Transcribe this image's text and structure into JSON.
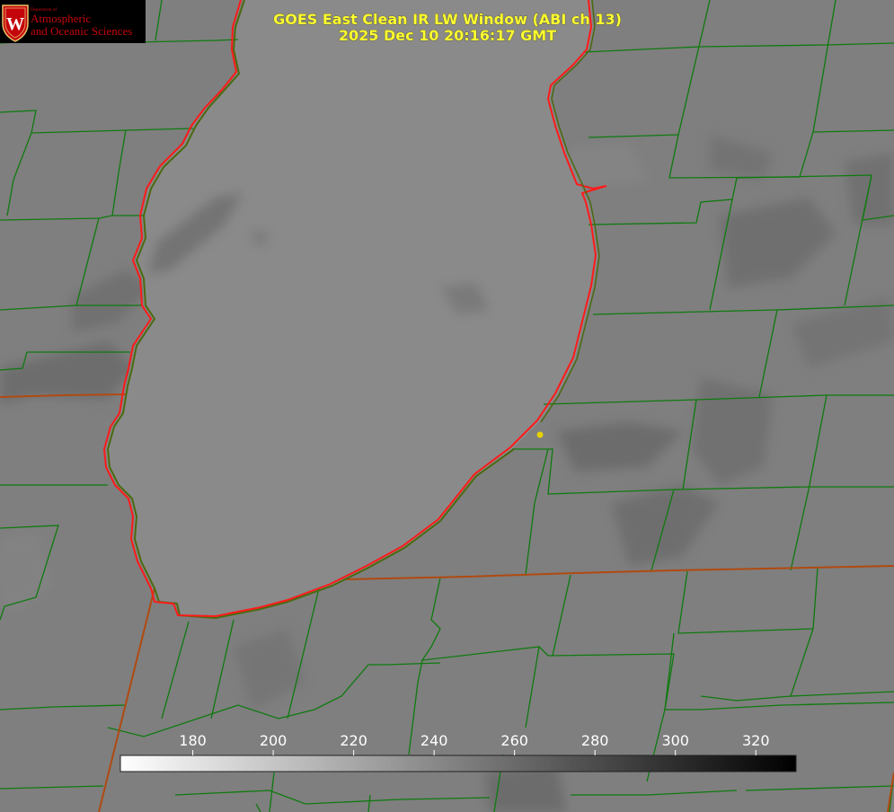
{
  "title": {
    "line1": "GOES East Clean IR LW Window (ABI ch 13)",
    "line2": "2025 Dec 10 20:16:17 GMT"
  },
  "logo": {
    "department": "Department of",
    "line1": "Atmospheric",
    "line2": "and Oceanic Sciences",
    "crest_letter": "W"
  },
  "colorbar": {
    "ticks": [
      180,
      200,
      220,
      240,
      260,
      280,
      300,
      320
    ],
    "range": [
      162,
      330
    ],
    "colormap": "white-to-black (cold bright, warm dark)"
  },
  "colors": {
    "background_gray": "#808080",
    "lake_gray": "#8a8a8a",
    "county_lines": "#0f7a0f",
    "state_lines": "#b04a10",
    "coastline": "#ff1a1a",
    "marker": "#e6d200",
    "title_text": "#ffff33"
  }
}
